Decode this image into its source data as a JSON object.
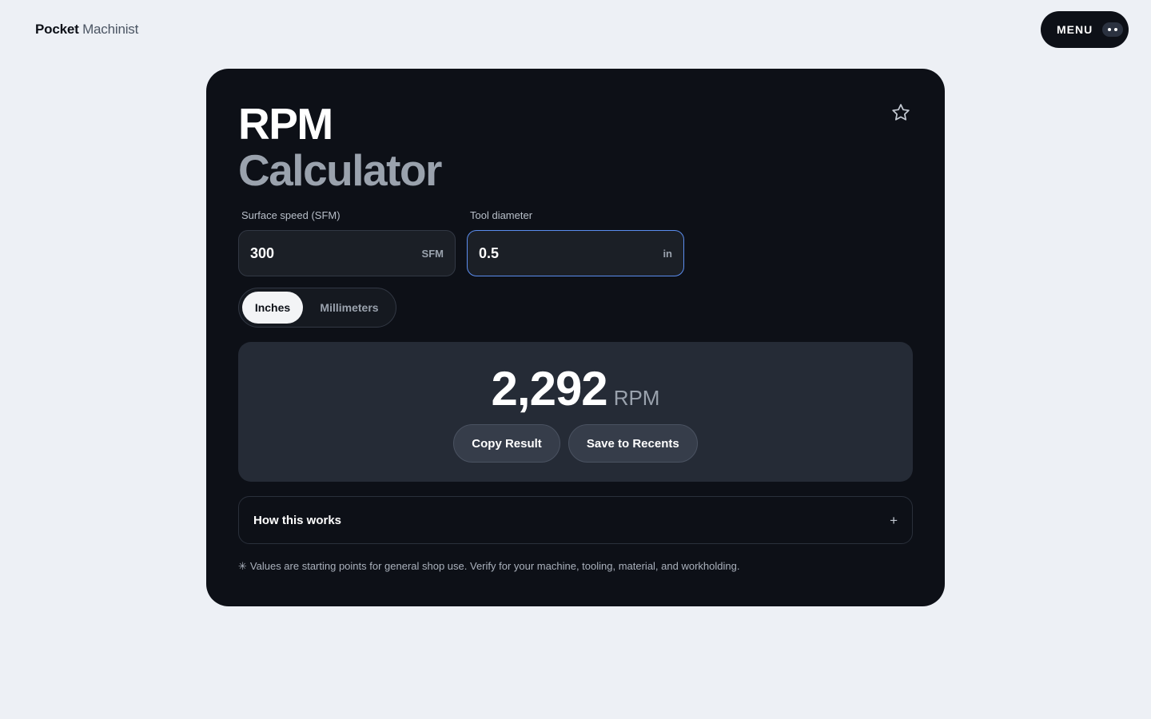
{
  "brand": {
    "primary": "Pocket",
    "secondary": "Machinist"
  },
  "menu": {
    "label": "MENU",
    "icon": "dots-icon"
  },
  "calculator": {
    "title_line1": "RPM",
    "title_line2": "Calculator",
    "favorite_icon": "star-icon",
    "surface_speed": {
      "label": "Surface speed (SFM)",
      "value": "300",
      "unit": "SFM"
    },
    "tool_diameter": {
      "label": "Tool diameter",
      "value": "0.5",
      "unit": "in"
    },
    "unit_toggle": {
      "options": [
        "Inches",
        "Millimeters"
      ],
      "selected": "Inches"
    },
    "result": {
      "value": "2,292",
      "unit": "RPM",
      "copy_label": "Copy Result",
      "save_label": "Save to Recents"
    },
    "how_it_works": {
      "title": "How this works",
      "expand_symbol": "+"
    },
    "disclaimer": {
      "symbol": "✳",
      "text": "Values are starting points for general shop use. Verify for your machine, tooling, material, and workholding."
    }
  },
  "colors": {
    "background": "#edf0f5",
    "card": "#0d1017",
    "result_panel": "#252b36",
    "focus_ring": "#5b8def"
  }
}
